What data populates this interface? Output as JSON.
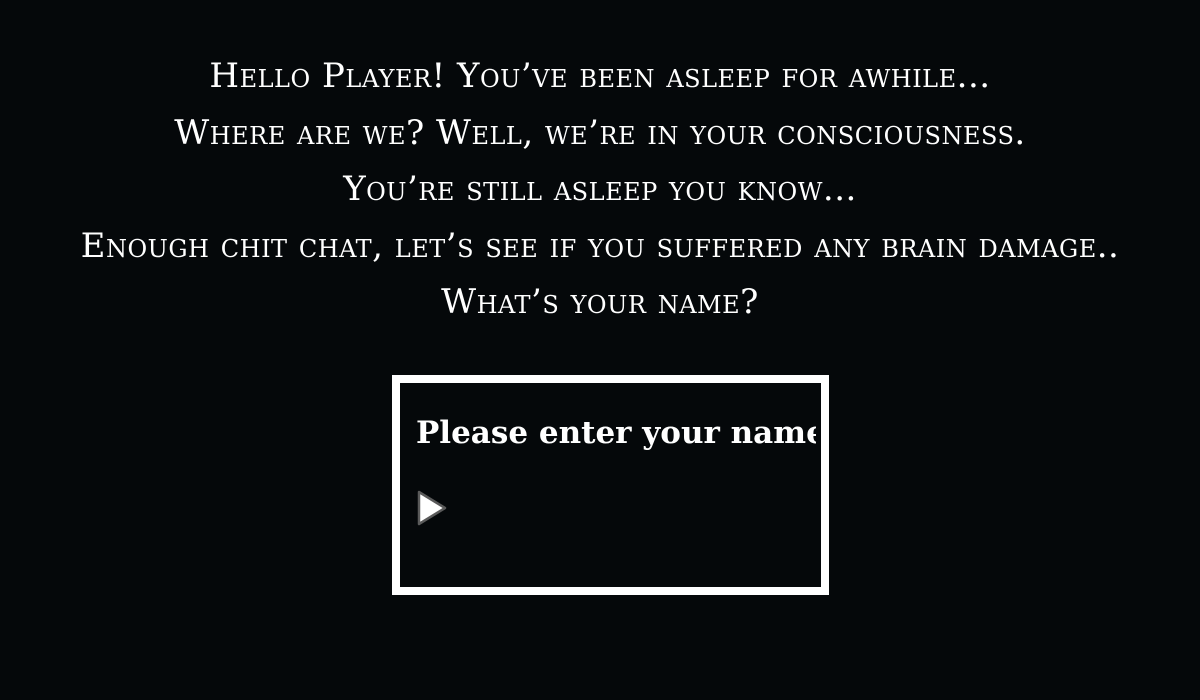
{
  "dialogue": {
    "lines": [
      "Hello Player! You’ve been asleep for awhile...",
      "Where are we? Well, we’re in your consciousness.",
      "You’re still asleep you know...",
      "Enough chit chat, let’s see if you suffered any brain damage..",
      "What’s your name?"
    ]
  },
  "name_prompt": {
    "placeholder": "Please enter your name...",
    "value": "",
    "submit_icon": "play-icon"
  },
  "colors": {
    "background": "#05080a",
    "text": "#ffffff",
    "box_border": "#ffffff"
  }
}
